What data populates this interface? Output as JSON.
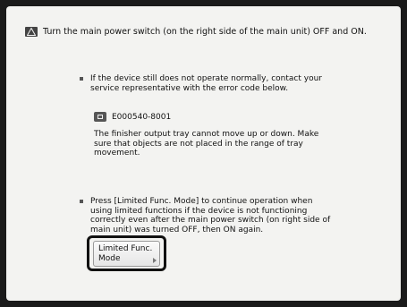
{
  "header": {
    "instruction": "Turn the main power switch (on the right side of the main unit) OFF and ON.",
    "icon": "warning-icon"
  },
  "contact": {
    "text": "If the device still does not operate normally, contact your service representative with the error code below."
  },
  "error": {
    "icon": "error-code-icon",
    "code": "E000540-8001",
    "description": "The finisher output tray cannot move up or down. Make sure that objects are not placed in the range of tray movement."
  },
  "limited": {
    "text": "Press [Limited Func. Mode] to continue operation when using limited functions if the device is not functioning correctly even after the main power switch (on right side of main unit) was turned OFF, then ON again.",
    "button_line1": "Limited Func.",
    "button_line2": "Mode"
  }
}
